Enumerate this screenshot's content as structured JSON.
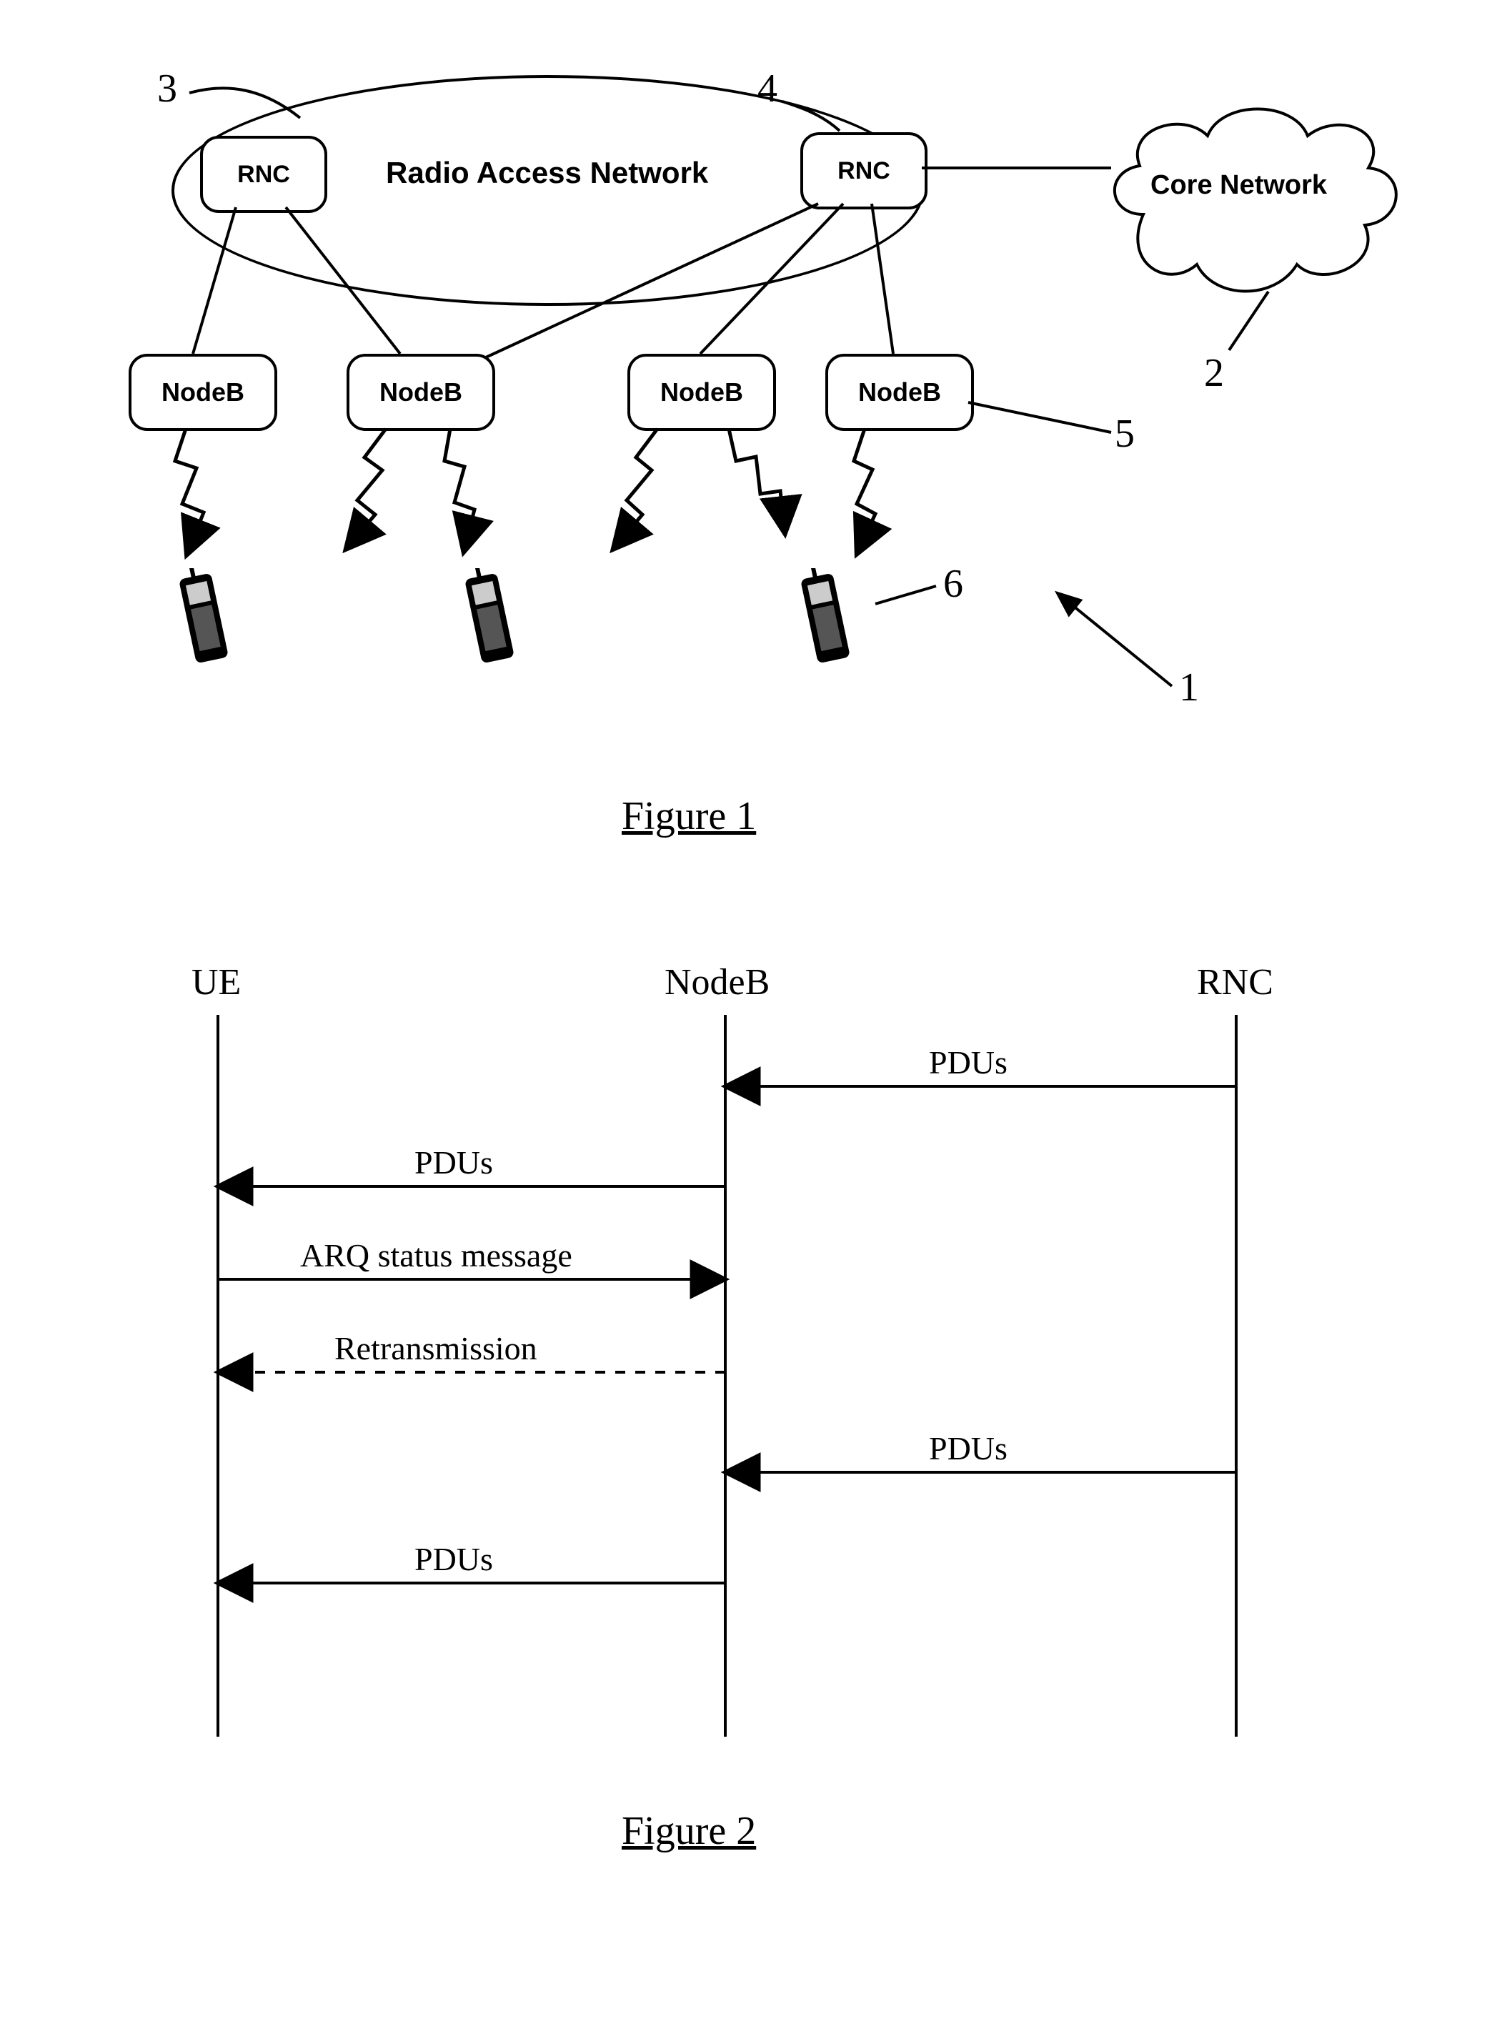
{
  "fig1": {
    "caption": "Figure 1",
    "ran_label": "Radio Access Network",
    "rnc": "RNC",
    "nodeb": "NodeB",
    "core_network": "Core Network",
    "refs": {
      "r1": "1",
      "r2": "2",
      "r3": "3",
      "r4": "4",
      "r5": "5",
      "r6": "6"
    }
  },
  "fig2": {
    "caption": "Figure 2",
    "lifelines": {
      "ue": "UE",
      "nodeb": "NodeB",
      "rnc": "RNC"
    },
    "msgs": {
      "pdus": "PDUs",
      "arq": "ARQ status message",
      "retx": "Retransmission"
    }
  }
}
